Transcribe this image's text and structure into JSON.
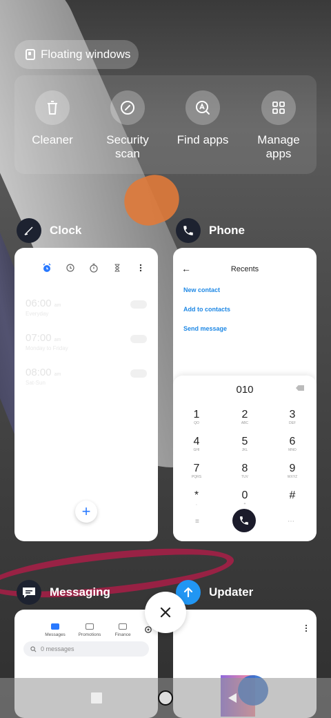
{
  "floating_windows": {
    "label": "Floating windows"
  },
  "quick_actions": [
    {
      "label": "Cleaner",
      "icon": "trash-icon"
    },
    {
      "label": "Security\nscan",
      "icon": "security-scan-icon"
    },
    {
      "label": "Find apps",
      "icon": "find-apps-icon"
    },
    {
      "label": "Manage\napps",
      "icon": "grid-icon"
    }
  ],
  "apps": {
    "clock": {
      "name": "Clock",
      "alarms": [
        {
          "time": "06:00",
          "suffix": "am",
          "days": "Everyday"
        },
        {
          "time": "07:00",
          "suffix": "am",
          "days": "Monday to Friday"
        },
        {
          "time": "08:00",
          "suffix": "am",
          "days": "Sat-Sun"
        }
      ],
      "fab": "+"
    },
    "phone": {
      "name": "Phone",
      "title": "Recents",
      "links": [
        "New contact",
        "Add to contacts",
        "Send message"
      ],
      "dialed": "010",
      "keys": [
        {
          "n": "1",
          "s": "QO"
        },
        {
          "n": "2",
          "s": "ABC"
        },
        {
          "n": "3",
          "s": "DEF"
        },
        {
          "n": "4",
          "s": "GHI"
        },
        {
          "n": "5",
          "s": "JKL"
        },
        {
          "n": "6",
          "s": "MNO"
        },
        {
          "n": "7",
          "s": "PQRS"
        },
        {
          "n": "8",
          "s": "TUV"
        },
        {
          "n": "9",
          "s": "WXYZ"
        },
        {
          "n": "*",
          "s": ","
        },
        {
          "n": "0",
          "s": "+"
        },
        {
          "n": "#",
          "s": ""
        }
      ]
    },
    "messaging": {
      "name": "Messaging",
      "tabs": [
        "Messages",
        "Promotions",
        "Finance"
      ],
      "search_placeholder": "0 messages"
    },
    "updater": {
      "name": "Updater"
    }
  },
  "colors": {
    "accent": "#2979ff",
    "link": "#1e88e5",
    "call": "#1b1b2b"
  }
}
